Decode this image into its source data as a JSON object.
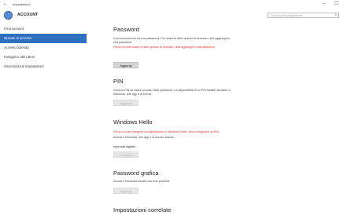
{
  "window": {
    "title": "Impostazioni",
    "back_glyph": "←",
    "min_glyph": "–",
    "max_glyph": "☐",
    "icon": "settings-gear-icon"
  },
  "header": {
    "page_title": "ACCOUNT",
    "search_placeholder": "Trova un'impostazione",
    "search_icon": "search-icon"
  },
  "sidebar": {
    "items": [
      {
        "label": "Il tuo account",
        "active": false
      },
      {
        "label": "Opzioni di accesso",
        "active": true
      },
      {
        "label": "Accesso azienda",
        "active": false
      },
      {
        "label": "Famiglia e altri utenti",
        "active": false
      },
      {
        "label": "Sincronizza le impostazioni",
        "active": false
      }
    ]
  },
  "sections": {
    "password": {
      "title": "Password",
      "text1": "Il tuo account non ha una password. Per usare le altre opzioni di accesso, devi aggiungere una password.",
      "warning": "Prima di poter usare le altre opzioni di accesso, devi aggiungere una password.",
      "button": "Aggiungi"
    },
    "pin": {
      "title": "PIN",
      "text1": "Crea un PIN da usare al posto delle password. La disponibilità di un PIN facilita l'accesso a Windows, alle app e ai servizi.",
      "button": "Aggiungi"
    },
    "hello": {
      "title": "Windows Hello",
      "warning": "Prima di poter eseguire la registrazione in Windows Hello, devi configurare un PIN.",
      "text1": "Accedi a Windows, alle app e ai servizi usando:",
      "sub_label": "Impronta digitale",
      "button": "Configura"
    },
    "picture": {
      "title": "Password grafica",
      "text1": "Accedi a Windows tramite una foto preferita",
      "button": "Aggiungi"
    },
    "related": {
      "title": "Impostazioni correlate"
    }
  }
}
